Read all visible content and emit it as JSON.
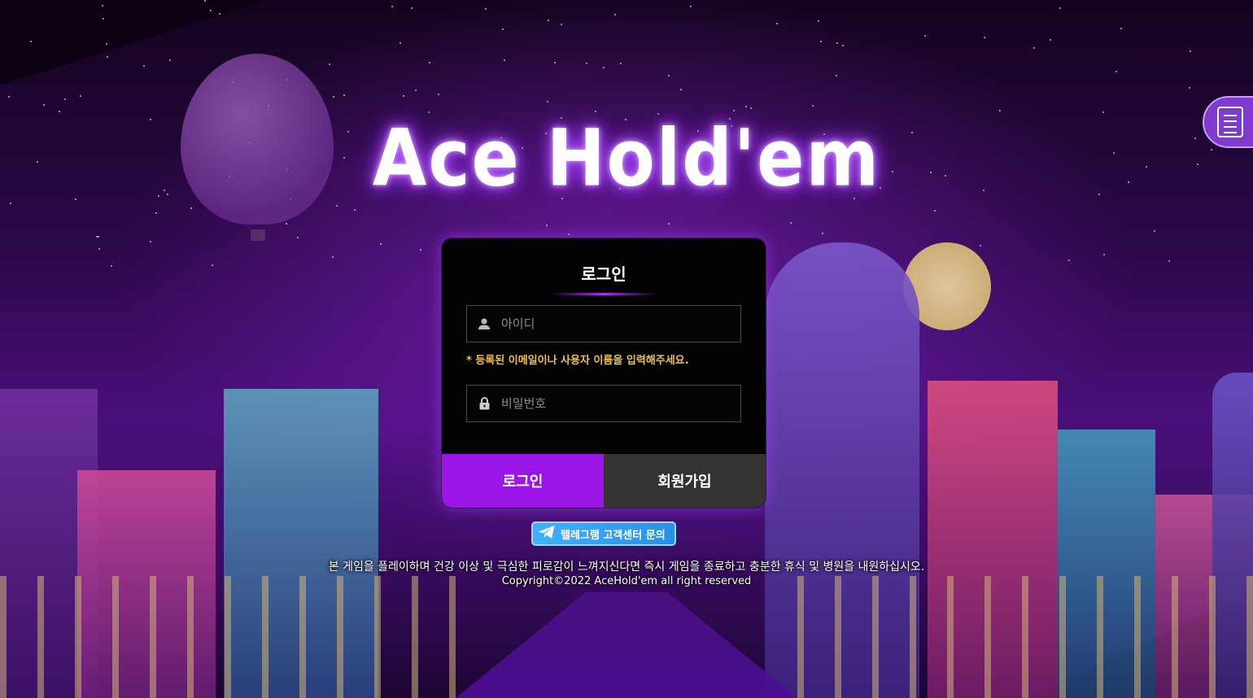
{
  "brand": {
    "logo_text": "Ace Hold'em",
    "accent": "#9a16e6"
  },
  "login_card": {
    "title": "로그인",
    "username_placeholder": "아이디",
    "username_icon": "user-icon",
    "hint": "* 등록된 이메일이나 사용자 이름을 입력해주세요.",
    "password_placeholder": "비밀번호",
    "password_icon": "lock-icon",
    "login_button": "로그인",
    "join_button": "회원가입"
  },
  "telegram": {
    "label": "텔레그램 고객센터 문의",
    "icon": "telegram-icon"
  },
  "side_widget": {
    "icon": "document-icon"
  },
  "footer": {
    "notice": "본 게임을 플레이하며 건강 이상 및 극심한 피로감이 느껴지신다면 즉시 게임을 종료하고 충분한 휴식 및 병원을 내원하십시오.",
    "copyright": "Copyright©2022 AceHold'em all right reserved"
  }
}
